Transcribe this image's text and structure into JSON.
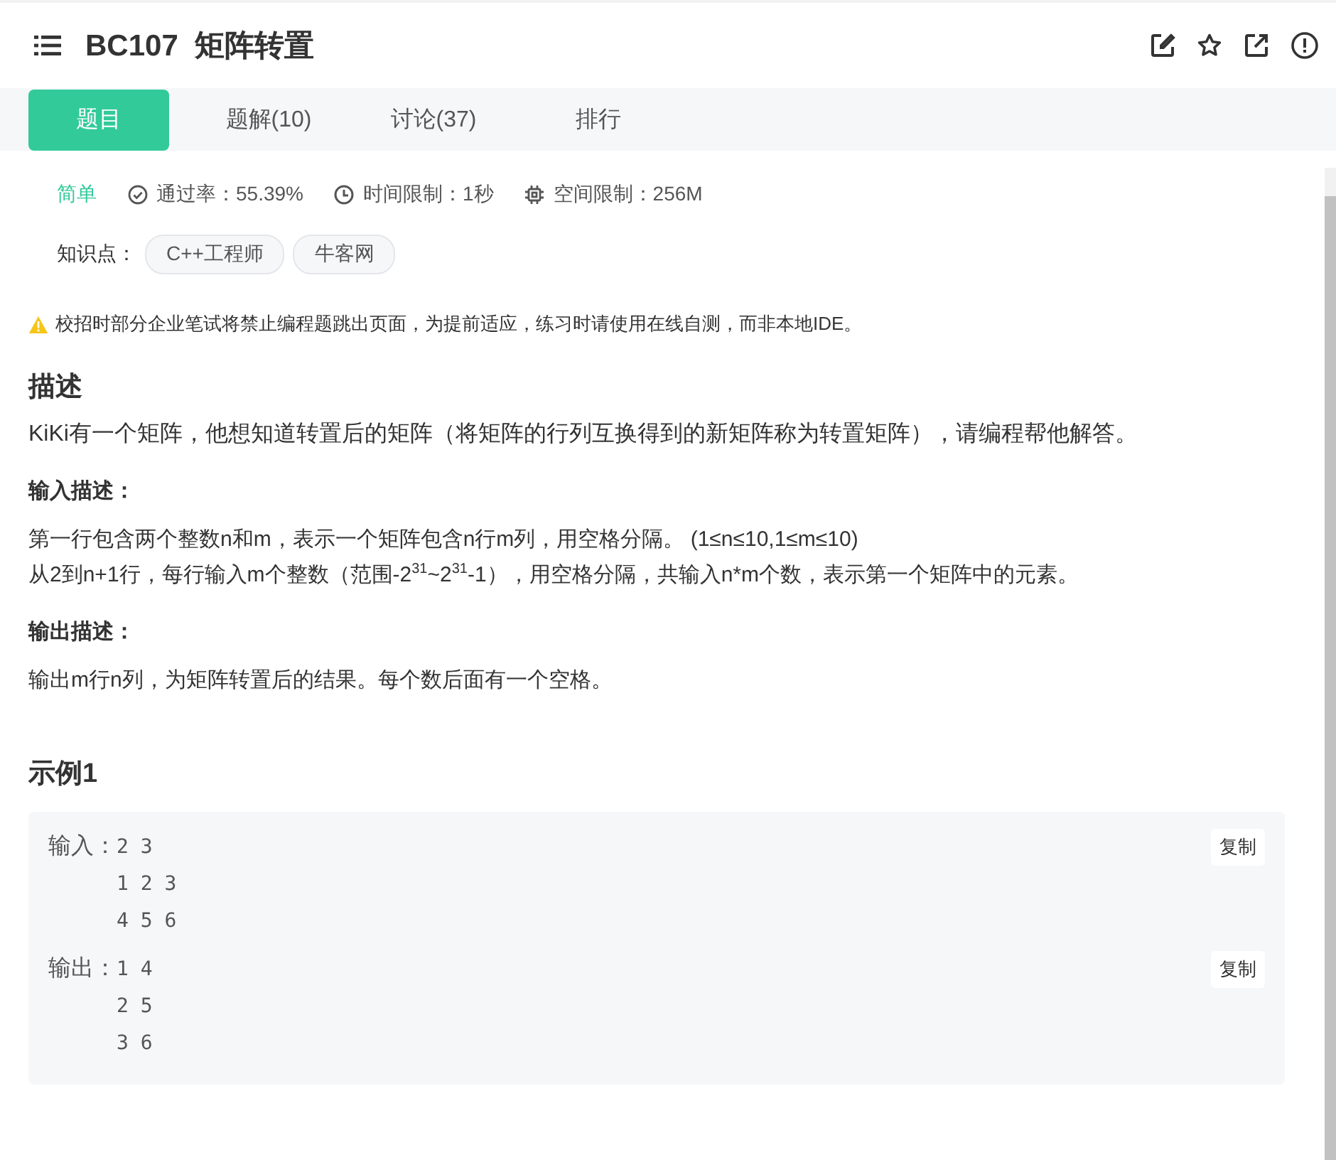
{
  "header": {
    "title": "BC107  矩阵转置"
  },
  "tabs": [
    {
      "label": "题目",
      "selected": true
    },
    {
      "label": "题解(10)",
      "selected": false
    },
    {
      "label": "讨论(37)",
      "selected": false
    },
    {
      "label": "排行",
      "selected": false
    }
  ],
  "meta": [
    {
      "kind": "difficulty",
      "text": "简单"
    },
    {
      "kind": "pass",
      "text": "通过率：55.39%"
    },
    {
      "kind": "time",
      "text": "时间限制：1秒"
    },
    {
      "kind": "memory",
      "text": "空间限制：256M"
    }
  ],
  "knowledge": {
    "label": "知识点：",
    "tags": [
      "C++工程师",
      "牛客网"
    ]
  },
  "notice": "校招时部分企业笔试将禁止编程题跳出页面，为提前适应，练习时请使用在线自测，而非本地IDE。",
  "description": {
    "heading": "描述",
    "text": "KiKi有一个矩阵，他想知道转置后的矩阵（将矩阵的行列互换得到的新矩阵称为转置矩阵），请编程帮他解答。"
  },
  "input_desc": {
    "heading": "输入描述：",
    "lines": [
      "第一行包含两个整数n和m，表示一个矩阵包含n行m列，用空格分隔。 (1≤n≤10,1≤m≤10)",
      "从2到n+1行，每行输入m个整数（范围-2$^{31}$~2$^{31}$-1），用空格分隔，共输入n*m个数，表示第一个矩阵中的元素。"
    ]
  },
  "output_desc": {
    "heading": "输出描述：",
    "lines": [
      "输出m行n列，为矩阵转置后的结果。每个数后面有一个空格。"
    ]
  },
  "example": {
    "heading": "示例1",
    "blocks": [
      {
        "label": "输入：",
        "lines": [
          "2 3",
          "1 2 3",
          "4 5 6"
        ],
        "copy": "复制"
      },
      {
        "label": "输出：",
        "lines": [
          "1 4",
          "2 5",
          "3 6"
        ],
        "copy": "复制"
      }
    ]
  }
}
